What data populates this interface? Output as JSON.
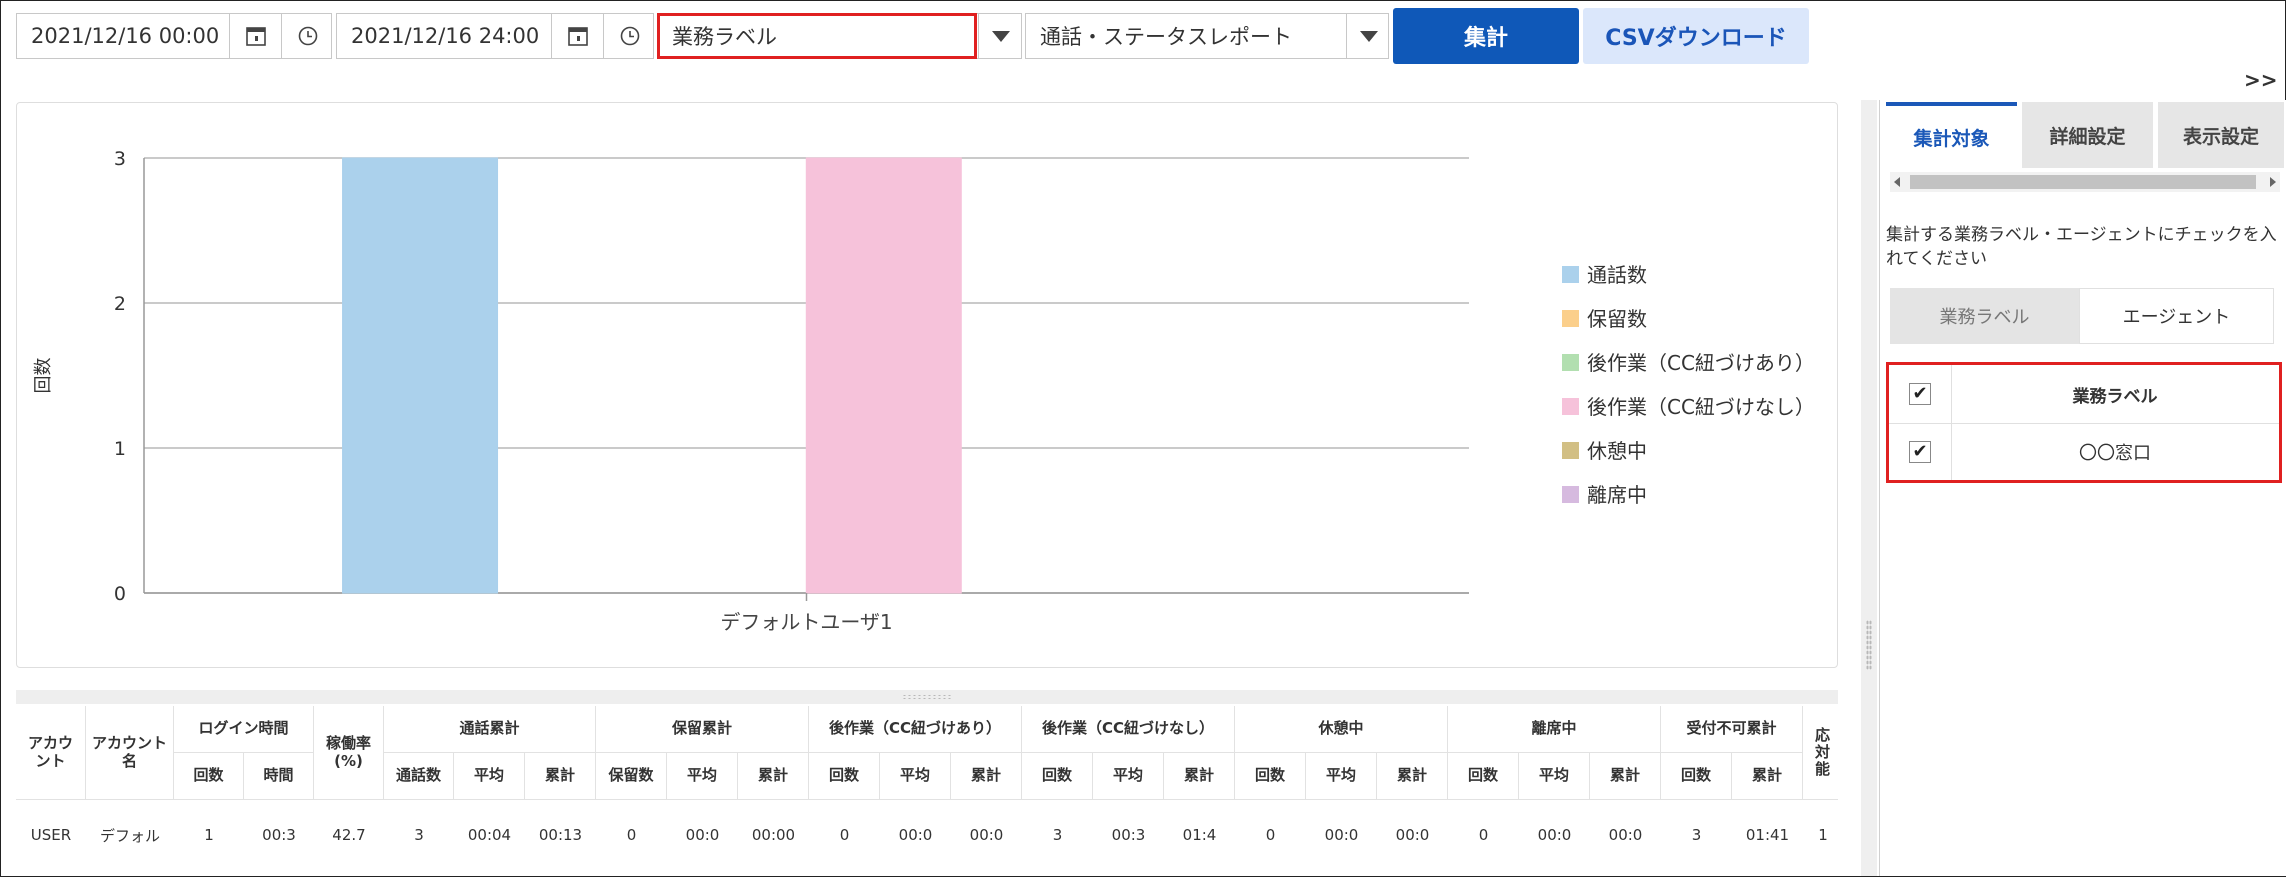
{
  "toolbar": {
    "start_datetime": "2021/12/16 00:00",
    "end_datetime": "2021/12/16 24:00",
    "label_select": "業務ラベル",
    "report_select": "通話・ステータスレポート",
    "aggregate_button": "集計",
    "csv_button": "CSVダウンロード",
    "expand_toggle": ">>"
  },
  "chart_data": {
    "type": "bar",
    "categories": [
      "デフォルトユーザ1"
    ],
    "series": [
      {
        "name": "通話数",
        "color": "#abd1ec",
        "values": [
          3
        ]
      },
      {
        "name": "保留数",
        "color": "#fbcf8b",
        "values": [
          0
        ]
      },
      {
        "name": "後作業（CC紐づけあり）",
        "color": "#b2dfb0",
        "values": [
          0
        ]
      },
      {
        "name": "後作業（CC紐づけなし）",
        "color": "#f6c2da",
        "values": [
          3
        ]
      },
      {
        "name": "休憩中",
        "color": "#d2bf84",
        "values": [
          0
        ]
      },
      {
        "name": "離席中",
        "color": "#d6badf",
        "values": [
          0
        ]
      }
    ],
    "ylabel": "回数",
    "ylim": [
      0,
      3
    ],
    "yticks": [
      "0",
      "1",
      "2",
      "3"
    ],
    "grid": true,
    "legend": "right"
  },
  "table": {
    "top_headers": [
      "アカウント",
      "アカウント名",
      "ログイン時間",
      "稼働率(%)",
      "通話累計",
      "保留累計",
      "後作業（CC紐づけあり）",
      "後作業（CC紐づけなし）",
      "休憩中",
      "離席中",
      "受付不可累計",
      "応対能"
    ],
    "sub_headers": [
      "回数",
      "時間",
      "通話数",
      "平均",
      "累計",
      "保留数",
      "平均",
      "累計",
      "回数",
      "平均",
      "累計",
      "回数",
      "平均",
      "累計",
      "回数",
      "平均",
      "累計",
      "回数",
      "平均",
      "累計",
      "回数",
      "累計"
    ],
    "row": [
      "USER",
      "デフォル",
      "1",
      "00:3",
      "42.7",
      "3",
      "00:04",
      "00:13",
      "0",
      "00:0",
      "00:00",
      "0",
      "00:0",
      "00:0",
      "3",
      "00:3",
      "01:4",
      "0",
      "00:0",
      "00:0",
      "0",
      "00:0",
      "00:0",
      "3",
      "01:41",
      "1"
    ]
  },
  "right_panel": {
    "tabs": [
      "集計対象",
      "詳細設定",
      "表示設定"
    ],
    "instruction": "集計する業務ラベル・エージェントにチェックを入れてください",
    "toggle": [
      "業務ラベル",
      "エージェント"
    ],
    "list_header": "業務ラベル",
    "list_items": [
      "〇〇窓口"
    ]
  }
}
